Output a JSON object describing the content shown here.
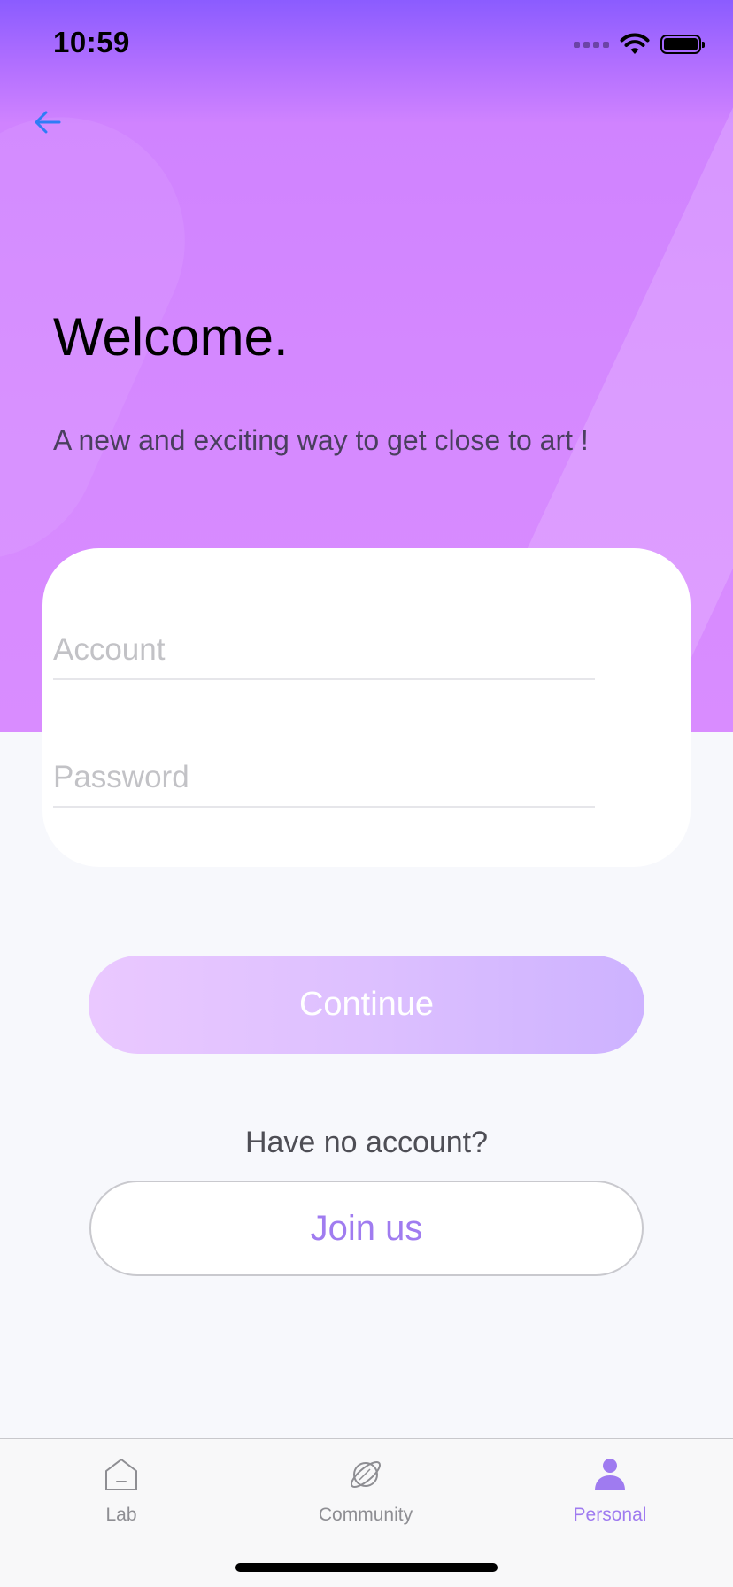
{
  "status_bar": {
    "time": "10:59"
  },
  "header": {
    "back_icon": "arrow-left-icon",
    "title": "Welcome.",
    "subtitle": "A new and exciting way to get close to art !"
  },
  "form": {
    "account": {
      "placeholder": "Account",
      "value": ""
    },
    "password": {
      "placeholder": "Password",
      "value": ""
    }
  },
  "actions": {
    "continue_label": "Continue",
    "no_account_text": "Have no account?",
    "join_label": "Join us"
  },
  "tab_bar": {
    "items": [
      {
        "label": "Lab",
        "icon": "house-icon",
        "active": false
      },
      {
        "label": "Community",
        "icon": "planet-icon",
        "active": false
      },
      {
        "label": "Personal",
        "icon": "person-icon",
        "active": true
      }
    ]
  },
  "colors": {
    "hero_gradient_top": "#8B5CFF",
    "hero_gradient_bottom": "#D98CFF",
    "accent": "#9F7BF0",
    "background": "#F7F8FC",
    "back_icon": "#2F7CF6"
  }
}
